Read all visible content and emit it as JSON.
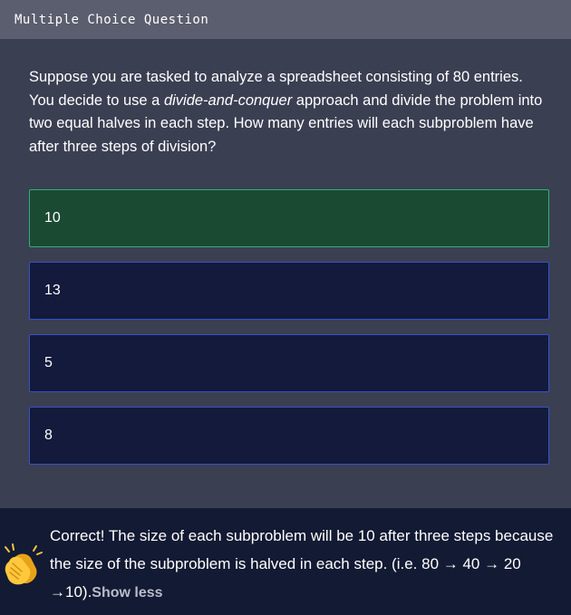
{
  "header": {
    "title": "Multiple Choice Question"
  },
  "question": {
    "text_before": "Suppose you are tasked to analyze a spreadsheet consisting of 80 entries. You decide to use a ",
    "emphasis": "divide-and-conquer",
    "text_after": " approach and divide the problem into two equal halves in each step. How many entries will each subproblem have after three steps of division?"
  },
  "options": [
    {
      "label": "10",
      "state": "correct"
    },
    {
      "label": "13",
      "state": "default"
    },
    {
      "label": "5",
      "state": "default"
    },
    {
      "label": "8",
      "state": "default"
    }
  ],
  "feedback": {
    "icon": "clapping-hands-icon",
    "text": "Correct! The size of each subproblem will be 10 after three steps because the size of the subproblem is halved in each step. (i.e. 80 → 40 → 20 →10).",
    "toggle_label": "Show less"
  },
  "colors": {
    "background": "#3b3f52",
    "header": "#5b5e6e",
    "option_bg": "#131a3b",
    "option_border": "#3352c8",
    "correct_bg": "#1b4a33",
    "correct_border": "#2fb07a",
    "feedback_bg": "#131a33"
  }
}
